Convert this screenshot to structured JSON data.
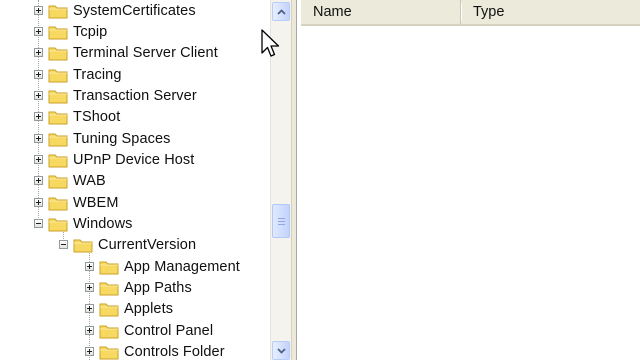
{
  "tree": {
    "items": [
      {
        "label": "SystemCertificates",
        "state": "collapsed"
      },
      {
        "label": "Tcpip",
        "state": "collapsed"
      },
      {
        "label": "Terminal Server Client",
        "state": "collapsed"
      },
      {
        "label": "Tracing",
        "state": "collapsed"
      },
      {
        "label": "Transaction Server",
        "state": "collapsed"
      },
      {
        "label": "TShoot",
        "state": "collapsed"
      },
      {
        "label": "Tuning Spaces",
        "state": "collapsed"
      },
      {
        "label": "UPnP Device Host",
        "state": "collapsed"
      },
      {
        "label": "WAB",
        "state": "collapsed"
      },
      {
        "label": "WBEM",
        "state": "collapsed"
      },
      {
        "label": "Windows",
        "state": "expanded"
      },
      {
        "label": "CurrentVersion",
        "state": "expanded"
      },
      {
        "label": "App Management",
        "state": "collapsed"
      },
      {
        "label": "App Paths",
        "state": "collapsed"
      },
      {
        "label": "Applets",
        "state": "collapsed"
      },
      {
        "label": "Control Panel",
        "state": "collapsed"
      },
      {
        "label": "Controls Folder",
        "state": "collapsed"
      }
    ]
  },
  "list": {
    "columns": [
      {
        "label": "Name"
      },
      {
        "label": "Type"
      }
    ]
  },
  "colors": {
    "folder_fill": "#f7d861",
    "folder_edge": "#c9a227",
    "scrollbar_accent": "#c3d3fd"
  },
  "icons": {
    "expand": "plus-box-icon",
    "collapse": "minus-box-icon",
    "folder": "folder-icon",
    "scroll_up": "chevron-up-icon",
    "scroll_down": "chevron-down-icon"
  }
}
